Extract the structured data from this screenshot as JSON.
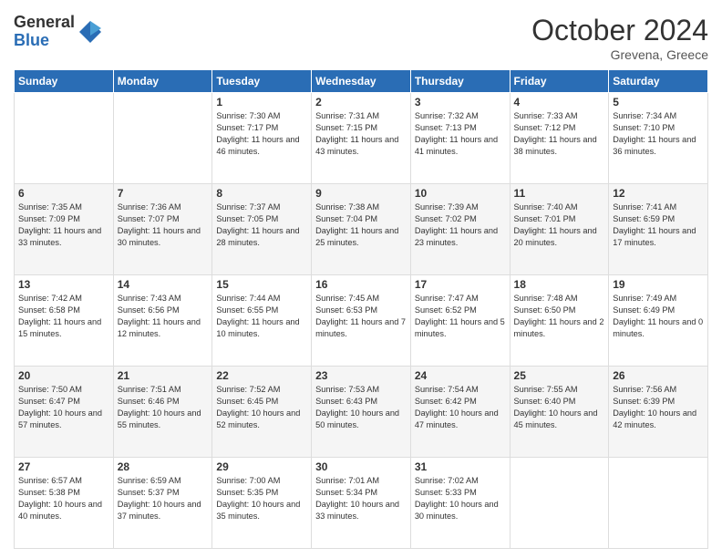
{
  "logo": {
    "general": "General",
    "blue": "Blue"
  },
  "header": {
    "month": "October 2024",
    "location": "Grevena, Greece"
  },
  "weekdays": [
    "Sunday",
    "Monday",
    "Tuesday",
    "Wednesday",
    "Thursday",
    "Friday",
    "Saturday"
  ],
  "weeks": [
    [
      {
        "day": "",
        "sunrise": "",
        "sunset": "",
        "daylight": ""
      },
      {
        "day": "",
        "sunrise": "",
        "sunset": "",
        "daylight": ""
      },
      {
        "day": "1",
        "sunrise": "Sunrise: 7:30 AM",
        "sunset": "Sunset: 7:17 PM",
        "daylight": "Daylight: 11 hours and 46 minutes."
      },
      {
        "day": "2",
        "sunrise": "Sunrise: 7:31 AM",
        "sunset": "Sunset: 7:15 PM",
        "daylight": "Daylight: 11 hours and 43 minutes."
      },
      {
        "day": "3",
        "sunrise": "Sunrise: 7:32 AM",
        "sunset": "Sunset: 7:13 PM",
        "daylight": "Daylight: 11 hours and 41 minutes."
      },
      {
        "day": "4",
        "sunrise": "Sunrise: 7:33 AM",
        "sunset": "Sunset: 7:12 PM",
        "daylight": "Daylight: 11 hours and 38 minutes."
      },
      {
        "day": "5",
        "sunrise": "Sunrise: 7:34 AM",
        "sunset": "Sunset: 7:10 PM",
        "daylight": "Daylight: 11 hours and 36 minutes."
      }
    ],
    [
      {
        "day": "6",
        "sunrise": "Sunrise: 7:35 AM",
        "sunset": "Sunset: 7:09 PM",
        "daylight": "Daylight: 11 hours and 33 minutes."
      },
      {
        "day": "7",
        "sunrise": "Sunrise: 7:36 AM",
        "sunset": "Sunset: 7:07 PM",
        "daylight": "Daylight: 11 hours and 30 minutes."
      },
      {
        "day": "8",
        "sunrise": "Sunrise: 7:37 AM",
        "sunset": "Sunset: 7:05 PM",
        "daylight": "Daylight: 11 hours and 28 minutes."
      },
      {
        "day": "9",
        "sunrise": "Sunrise: 7:38 AM",
        "sunset": "Sunset: 7:04 PM",
        "daylight": "Daylight: 11 hours and 25 minutes."
      },
      {
        "day": "10",
        "sunrise": "Sunrise: 7:39 AM",
        "sunset": "Sunset: 7:02 PM",
        "daylight": "Daylight: 11 hours and 23 minutes."
      },
      {
        "day": "11",
        "sunrise": "Sunrise: 7:40 AM",
        "sunset": "Sunset: 7:01 PM",
        "daylight": "Daylight: 11 hours and 20 minutes."
      },
      {
        "day": "12",
        "sunrise": "Sunrise: 7:41 AM",
        "sunset": "Sunset: 6:59 PM",
        "daylight": "Daylight: 11 hours and 17 minutes."
      }
    ],
    [
      {
        "day": "13",
        "sunrise": "Sunrise: 7:42 AM",
        "sunset": "Sunset: 6:58 PM",
        "daylight": "Daylight: 11 hours and 15 minutes."
      },
      {
        "day": "14",
        "sunrise": "Sunrise: 7:43 AM",
        "sunset": "Sunset: 6:56 PM",
        "daylight": "Daylight: 11 hours and 12 minutes."
      },
      {
        "day": "15",
        "sunrise": "Sunrise: 7:44 AM",
        "sunset": "Sunset: 6:55 PM",
        "daylight": "Daylight: 11 hours and 10 minutes."
      },
      {
        "day": "16",
        "sunrise": "Sunrise: 7:45 AM",
        "sunset": "Sunset: 6:53 PM",
        "daylight": "Daylight: 11 hours and 7 minutes."
      },
      {
        "day": "17",
        "sunrise": "Sunrise: 7:47 AM",
        "sunset": "Sunset: 6:52 PM",
        "daylight": "Daylight: 11 hours and 5 minutes."
      },
      {
        "day": "18",
        "sunrise": "Sunrise: 7:48 AM",
        "sunset": "Sunset: 6:50 PM",
        "daylight": "Daylight: 11 hours and 2 minutes."
      },
      {
        "day": "19",
        "sunrise": "Sunrise: 7:49 AM",
        "sunset": "Sunset: 6:49 PM",
        "daylight": "Daylight: 11 hours and 0 minutes."
      }
    ],
    [
      {
        "day": "20",
        "sunrise": "Sunrise: 7:50 AM",
        "sunset": "Sunset: 6:47 PM",
        "daylight": "Daylight: 10 hours and 57 minutes."
      },
      {
        "day": "21",
        "sunrise": "Sunrise: 7:51 AM",
        "sunset": "Sunset: 6:46 PM",
        "daylight": "Daylight: 10 hours and 55 minutes."
      },
      {
        "day": "22",
        "sunrise": "Sunrise: 7:52 AM",
        "sunset": "Sunset: 6:45 PM",
        "daylight": "Daylight: 10 hours and 52 minutes."
      },
      {
        "day": "23",
        "sunrise": "Sunrise: 7:53 AM",
        "sunset": "Sunset: 6:43 PM",
        "daylight": "Daylight: 10 hours and 50 minutes."
      },
      {
        "day": "24",
        "sunrise": "Sunrise: 7:54 AM",
        "sunset": "Sunset: 6:42 PM",
        "daylight": "Daylight: 10 hours and 47 minutes."
      },
      {
        "day": "25",
        "sunrise": "Sunrise: 7:55 AM",
        "sunset": "Sunset: 6:40 PM",
        "daylight": "Daylight: 10 hours and 45 minutes."
      },
      {
        "day": "26",
        "sunrise": "Sunrise: 7:56 AM",
        "sunset": "Sunset: 6:39 PM",
        "daylight": "Daylight: 10 hours and 42 minutes."
      }
    ],
    [
      {
        "day": "27",
        "sunrise": "Sunrise: 6:57 AM",
        "sunset": "Sunset: 5:38 PM",
        "daylight": "Daylight: 10 hours and 40 minutes."
      },
      {
        "day": "28",
        "sunrise": "Sunrise: 6:59 AM",
        "sunset": "Sunset: 5:37 PM",
        "daylight": "Daylight: 10 hours and 37 minutes."
      },
      {
        "day": "29",
        "sunrise": "Sunrise: 7:00 AM",
        "sunset": "Sunset: 5:35 PM",
        "daylight": "Daylight: 10 hours and 35 minutes."
      },
      {
        "day": "30",
        "sunrise": "Sunrise: 7:01 AM",
        "sunset": "Sunset: 5:34 PM",
        "daylight": "Daylight: 10 hours and 33 minutes."
      },
      {
        "day": "31",
        "sunrise": "Sunrise: 7:02 AM",
        "sunset": "Sunset: 5:33 PM",
        "daylight": "Daylight: 10 hours and 30 minutes."
      },
      {
        "day": "",
        "sunrise": "",
        "sunset": "",
        "daylight": ""
      },
      {
        "day": "",
        "sunrise": "",
        "sunset": "",
        "daylight": ""
      }
    ]
  ]
}
